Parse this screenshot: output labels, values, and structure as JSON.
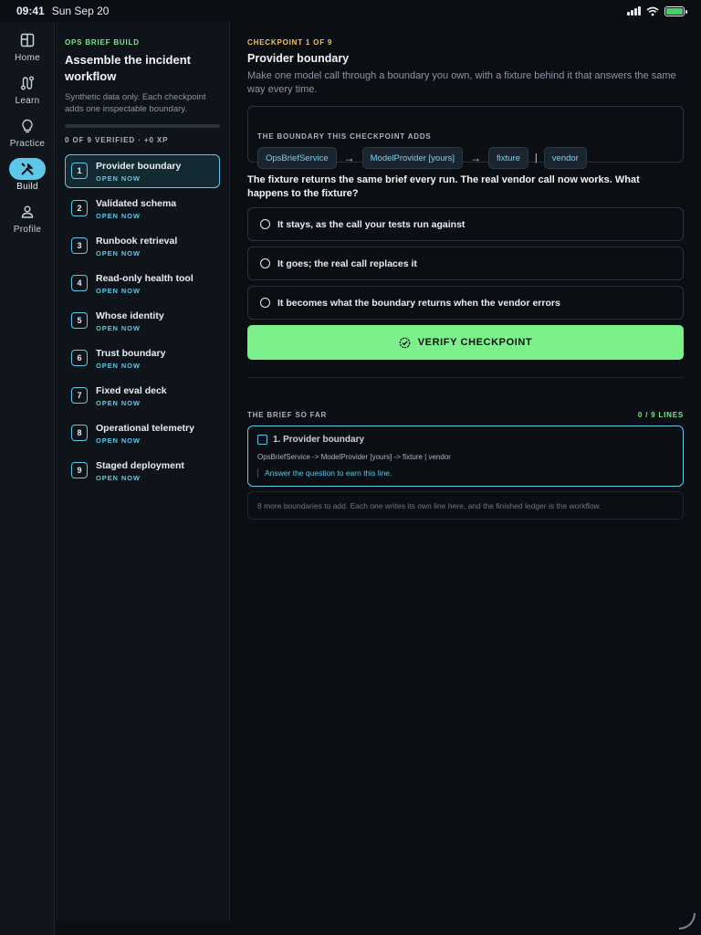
{
  "status_bar": {
    "time": "09:41",
    "date": "Sun Sep 20"
  },
  "rail": {
    "items": [
      {
        "label": "Home",
        "icon": "layout-icon",
        "active": false
      },
      {
        "label": "Learn",
        "icon": "route-icon",
        "active": false
      },
      {
        "label": "Practice",
        "icon": "bulb-icon",
        "active": false
      },
      {
        "label": "Build",
        "icon": "tools-icon",
        "active": true
      },
      {
        "label": "Profile",
        "icon": "user-icon",
        "active": false
      }
    ]
  },
  "sidebar": {
    "eyebrow": "OPS BRIEF BUILD",
    "title": "Assemble the incident workflow",
    "subtitle": "Synthetic data only. Each checkpoint adds one inspectable boundary.",
    "progress": 0,
    "verified_text": "0 OF 9 VERIFIED · +0 XP",
    "steps": [
      {
        "num": "1",
        "title": "Provider boundary",
        "status": "OPEN NOW"
      },
      {
        "num": "2",
        "title": "Validated schema",
        "status": "OPEN NOW"
      },
      {
        "num": "3",
        "title": "Runbook retrieval",
        "status": "OPEN NOW"
      },
      {
        "num": "4",
        "title": "Read-only health tool",
        "status": "OPEN NOW"
      },
      {
        "num": "5",
        "title": "Whose identity",
        "status": "OPEN NOW"
      },
      {
        "num": "6",
        "title": "Trust boundary",
        "status": "OPEN NOW"
      },
      {
        "num": "7",
        "title": "Fixed eval deck",
        "status": "OPEN NOW"
      },
      {
        "num": "8",
        "title": "Operational telemetry",
        "status": "OPEN NOW"
      },
      {
        "num": "9",
        "title": "Staged deployment",
        "status": "OPEN NOW"
      }
    ]
  },
  "main": {
    "eyebrow": "CHECKPOINT 1 OF 9",
    "title": "Provider boundary",
    "description": "Make one model call through a boundary you own, with a fixture behind it that answers the same way every time.",
    "boundary_label": "THE BOUNDARY THIS CHECKPOINT ADDS",
    "chips": [
      "OpsBriefService",
      "ModelProvider [yours]",
      "fixture",
      "vendor"
    ],
    "arrow": "→",
    "pipe": "|",
    "question": "The fixture returns the same brief every run. The real vendor call now works. What happens to the fixture?",
    "options": [
      "It stays, as the call your tests run against",
      "It goes; the real call replaces it",
      "It becomes what the boundary returns when the vendor errors"
    ],
    "verify_label": "VERIFY CHECKPOINT",
    "brief_label": "THE BRIEF SO FAR",
    "brief_count": "0 / 9 LINES",
    "brief_item_title": "1. Provider boundary",
    "brief_item_path": "OpsBriefService -> ModelProvider [yours] -> fixture | vendor",
    "brief_item_hint": "Answer the question to earn this line.",
    "more_text": "8 more boundaries to add. Each one writes its own line here, and the finished ledger is the workflow."
  }
}
